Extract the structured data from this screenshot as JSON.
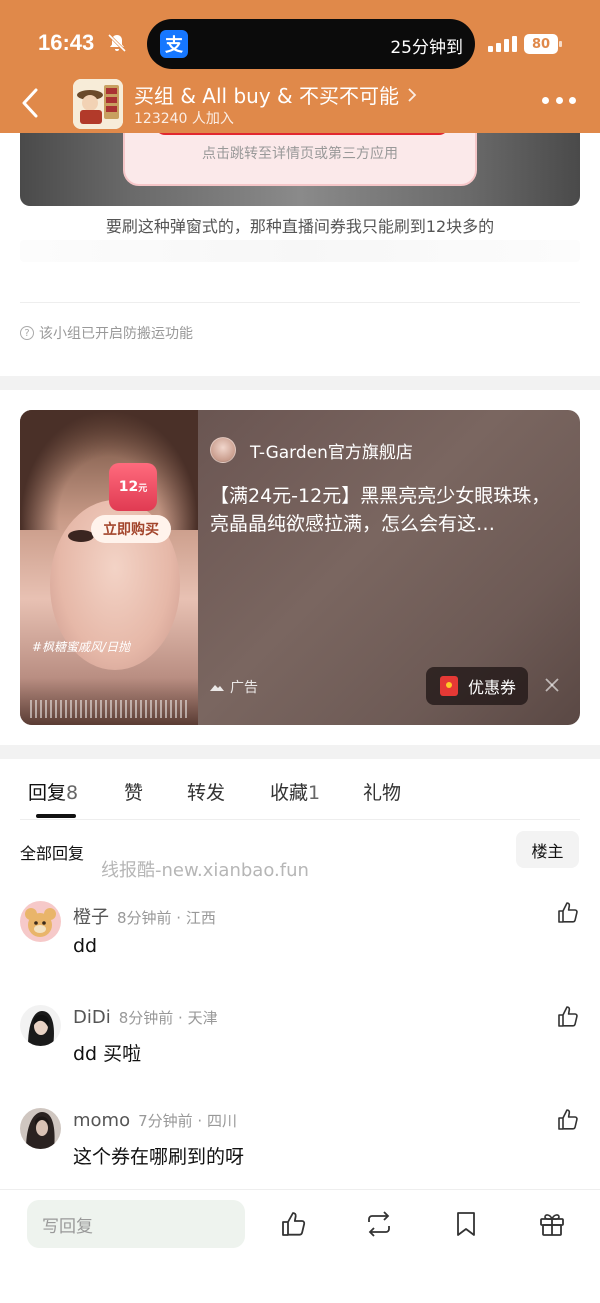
{
  "status_bar": {
    "time": "16:43",
    "island_text": "25分钟到",
    "alipay_glyph": "支",
    "battery": "80"
  },
  "header": {
    "group_name": "买组 & All buy & 不买不可能",
    "members": "123240 人加入",
    "background_color": "#e0894a"
  },
  "post": {
    "popup_text": "点击跳转至详情页或第三方应用",
    "caption": "要刷这种弹窗式的，那种直播间券我只能刷到12块多的",
    "anti_copy_notice": "该小组已开启防搬运功能"
  },
  "ad": {
    "coupon_amount": "12",
    "coupon_unit": "元",
    "buy_now": "立即购买",
    "hashtag": "#枫糖蜜戚风/日抛",
    "shop_name": "T-Garden官方旗舰店",
    "title": "【满24元-12元】黑黑亮亮少女眼珠珠，亮晶晶纯欲感拉满，怎么会有这…",
    "ad_label": "广告",
    "coupon_button": "优惠券"
  },
  "tabs": [
    {
      "label": "回复",
      "count": "8"
    },
    {
      "label": "赞",
      "count": ""
    },
    {
      "label": "转发",
      "count": ""
    },
    {
      "label": "收藏",
      "count": "1"
    },
    {
      "label": "礼物",
      "count": ""
    }
  ],
  "replies_section": {
    "all_replies": "全部回复",
    "owner_filter": "楼主",
    "watermark": "线报酷-new.xianbao.fun"
  },
  "replies": [
    {
      "name": "橙子",
      "info": "8分钟前 · 江西",
      "text": "dd"
    },
    {
      "name": "DiDi",
      "info": "8分钟前 · 天津",
      "text": "dd 买啦"
    },
    {
      "name": "momo",
      "info": "7分钟前 · 四川",
      "text": "这个券在哪刷到的呀"
    }
  ],
  "bottom_bar": {
    "reply_placeholder": "写回复"
  }
}
